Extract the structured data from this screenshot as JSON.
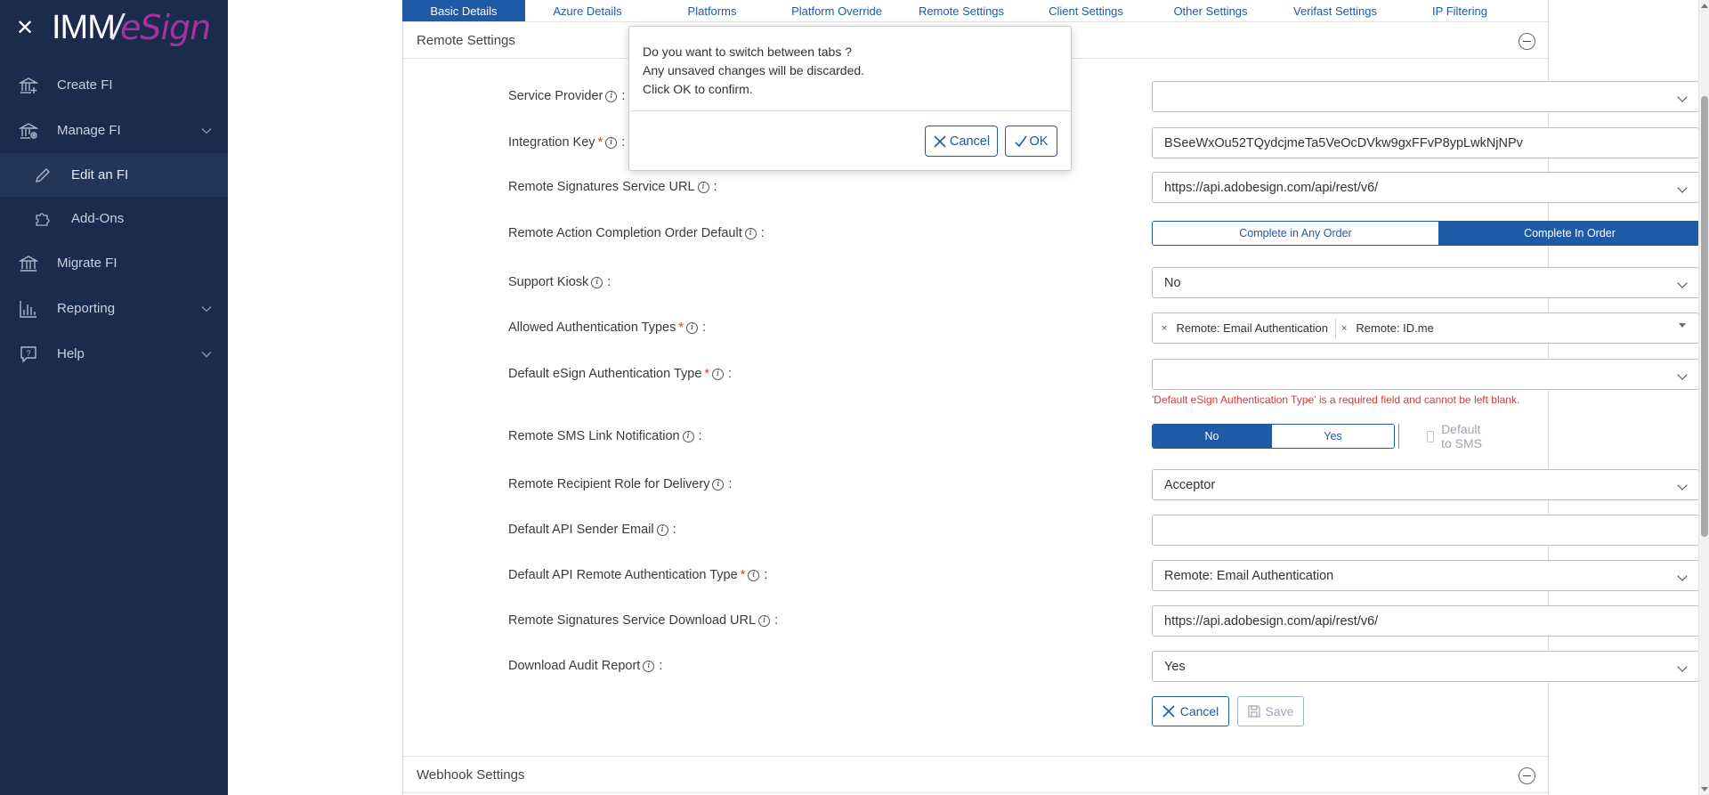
{
  "sidebar": {
    "close_icon": "close-icon",
    "logo": {
      "part1": "IMM",
      "part2": "eSign"
    },
    "items": [
      {
        "label": "Create FI",
        "icon": "bank-plus-icon"
      },
      {
        "label": "Manage FI",
        "icon": "bank-gear-icon",
        "expanded": true
      },
      {
        "label": "Edit an FI",
        "icon": "pencil-icon",
        "sub": true,
        "active": true
      },
      {
        "label": "Add-Ons",
        "icon": "puzzle-icon",
        "sub": true
      },
      {
        "label": "Migrate FI",
        "icon": "bank-icon"
      },
      {
        "label": "Reporting",
        "icon": "bar-chart-icon"
      },
      {
        "label": "Help",
        "icon": "help-chat-icon"
      }
    ]
  },
  "tabs": [
    "Basic Details",
    "Azure Details",
    "Platforms",
    "Platform Override",
    "Remote Settings",
    "Client Settings",
    "Other Settings",
    "Verifast Settings",
    "IP Filtering"
  ],
  "remote_settings": {
    "title": "Remote Settings",
    "fields": {
      "service_provider": {
        "label": "Service Provider",
        "value": ""
      },
      "integration_key": {
        "label": "Integration Key",
        "value": "BSeeWxOu52TQydcjmeTa5VeOcDVkw9gxFFvP8ypLwkNjNPv"
      },
      "service_url": {
        "label": "Remote Signatures Service URL",
        "value": "https://api.adobesign.com/api/rest/v6/"
      },
      "completion_order": {
        "label": "Remote Action Completion Order Default",
        "options": [
          "Complete in Any Order",
          "Complete In Order"
        ],
        "selected": "Complete In Order"
      },
      "support_kiosk": {
        "label": "Support Kiosk",
        "value": "No"
      },
      "allowed_auth": {
        "label": "Allowed Authentication Types",
        "chips": [
          "Remote: Email Authentication",
          "Remote: ID.me"
        ]
      },
      "default_auth": {
        "label": "Default eSign Authentication Type",
        "value": "",
        "error": "'Default eSign Authentication Type' is a required field and cannot be left blank."
      },
      "sms_link": {
        "label": "Remote SMS Link Notification",
        "options": [
          "No",
          "Yes"
        ],
        "selected": "No",
        "default_label": "Default to SMS"
      },
      "recipient_role": {
        "label": "Remote Recipient Role for Delivery",
        "value": "Acceptor"
      },
      "api_sender_email": {
        "label": "Default API Sender Email",
        "value": ""
      },
      "api_remote_auth": {
        "label": "Default API Remote Authentication Type",
        "value": "Remote: Email Authentication"
      },
      "download_url": {
        "label": "Remote Signatures Service Download URL",
        "value": "https://api.adobesign.com/api/rest/v6/"
      },
      "audit_report": {
        "label": "Download Audit Report",
        "value": "Yes"
      }
    },
    "buttons": {
      "cancel": "Cancel",
      "save": "Save"
    }
  },
  "webhook_settings": {
    "title": "Webhook Settings"
  },
  "modal": {
    "line1": "Do you want to switch between tabs ?",
    "line2": "Any unsaved changes will be discarded.",
    "line3": "Click OK to confirm.",
    "cancel": "Cancel",
    "ok": "OK"
  },
  "colors": {
    "sidebar_bg": "#1b2b4e",
    "accent": "#1f5aa6",
    "error": "#d43a3a",
    "logo_accent": "#a8329d"
  }
}
